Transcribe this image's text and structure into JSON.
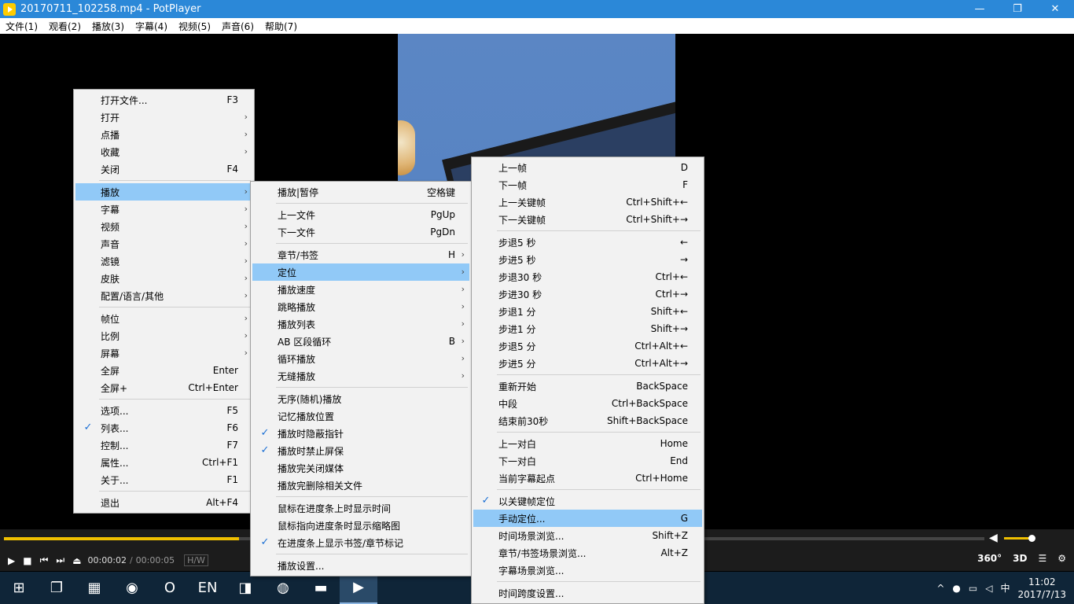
{
  "window": {
    "title": "20170711_102258.mp4 - PotPlayer",
    "min": "—",
    "max": "❐",
    "close": "✕"
  },
  "menubar": [
    "文件(1)",
    "观看(2)",
    "播放(3)",
    "字幕(4)",
    "视频(5)",
    "声音(6)",
    "帮助(7)"
  ],
  "player": {
    "time_current": "00:00:02",
    "time_sep": "/",
    "time_total": "00:00:05",
    "hw": "H/W",
    "progress_fraction": 0.24,
    "volume_fraction": 0.9,
    "btn_360": "360°",
    "btn_3d": "3D",
    "colors": {
      "accent": "#f0c000",
      "highlight": "#91c9f7",
      "titlebar": "#2b88d8"
    }
  },
  "menu_main": [
    {
      "label": "打开文件...",
      "shortcut": "F3"
    },
    {
      "label": "打开",
      "submenu": true
    },
    {
      "label": "点播",
      "submenu": true
    },
    {
      "label": "收藏",
      "submenu": true
    },
    {
      "label": "关闭",
      "shortcut": "F4"
    },
    {
      "sep": true
    },
    {
      "label": "播放",
      "submenu": true,
      "highlighted": true
    },
    {
      "label": "字幕",
      "submenu": true
    },
    {
      "label": "视频",
      "submenu": true
    },
    {
      "label": "声音",
      "submenu": true
    },
    {
      "label": "滤镜",
      "submenu": true
    },
    {
      "label": "皮肤",
      "submenu": true
    },
    {
      "label": "配置/语言/其他",
      "submenu": true
    },
    {
      "sep": true
    },
    {
      "label": "帧位",
      "submenu": true
    },
    {
      "label": "比例",
      "submenu": true
    },
    {
      "label": "屏幕",
      "submenu": true
    },
    {
      "label": "全屏",
      "shortcut": "Enter"
    },
    {
      "label": "全屏+",
      "shortcut": "Ctrl+Enter"
    },
    {
      "sep": true
    },
    {
      "label": "选项...",
      "shortcut": "F5"
    },
    {
      "label": "列表...",
      "shortcut": "F6",
      "checked": true
    },
    {
      "label": "控制...",
      "shortcut": "F7"
    },
    {
      "label": "属性...",
      "shortcut": "Ctrl+F1"
    },
    {
      "label": "关于...",
      "shortcut": "F1"
    },
    {
      "sep": true
    },
    {
      "label": "退出",
      "shortcut": "Alt+F4"
    }
  ],
  "menu_play": [
    {
      "label": "播放|暂停",
      "shortcut": "空格键"
    },
    {
      "sep": true
    },
    {
      "label": "上一文件",
      "shortcut": "PgUp"
    },
    {
      "label": "下一文件",
      "shortcut": "PgDn"
    },
    {
      "sep": true
    },
    {
      "label": "章节/书签",
      "shortcut": "H",
      "submenu": true
    },
    {
      "label": "定位",
      "submenu": true,
      "highlighted": true
    },
    {
      "label": "播放速度",
      "submenu": true
    },
    {
      "label": "跳略播放",
      "submenu": true
    },
    {
      "label": "播放列表",
      "submenu": true
    },
    {
      "label": "AB 区段循环",
      "shortcut": "B",
      "submenu": true
    },
    {
      "label": "循环播放",
      "submenu": true
    },
    {
      "label": "无缝播放",
      "submenu": true
    },
    {
      "sep": true
    },
    {
      "label": "无序(随机)播放"
    },
    {
      "label": "记忆播放位置"
    },
    {
      "label": "播放时隐蔽指针",
      "checked": true
    },
    {
      "label": "播放时禁止屏保",
      "checked": true
    },
    {
      "label": "播放完关闭媒体"
    },
    {
      "label": "播放完删除相关文件"
    },
    {
      "sep": true
    },
    {
      "label": "鼠标在进度条上时显示时间"
    },
    {
      "label": "鼠标指向进度条时显示缩略图"
    },
    {
      "label": "在进度条上显示书签/章节标记",
      "checked": true
    },
    {
      "sep": true
    },
    {
      "label": "播放设置..."
    }
  ],
  "menu_seek": [
    {
      "label": "上一帧",
      "shortcut": "D"
    },
    {
      "label": "下一帧",
      "shortcut": "F"
    },
    {
      "label": "上一关键帧",
      "shortcut": "Ctrl+Shift+←"
    },
    {
      "label": "下一关键帧",
      "shortcut": "Ctrl+Shift+→"
    },
    {
      "sep": true
    },
    {
      "label": "步退5 秒",
      "shortcut": "←"
    },
    {
      "label": "步进5 秒",
      "shortcut": "→"
    },
    {
      "label": "步退30 秒",
      "shortcut": "Ctrl+←"
    },
    {
      "label": "步进30 秒",
      "shortcut": "Ctrl+→"
    },
    {
      "label": "步退1 分",
      "shortcut": "Shift+←"
    },
    {
      "label": "步进1 分",
      "shortcut": "Shift+→"
    },
    {
      "label": "步退5 分",
      "shortcut": "Ctrl+Alt+←"
    },
    {
      "label": "步进5 分",
      "shortcut": "Ctrl+Alt+→"
    },
    {
      "sep": true
    },
    {
      "label": "重新开始",
      "shortcut": "BackSpace"
    },
    {
      "label": "中段",
      "shortcut": "Ctrl+BackSpace"
    },
    {
      "label": "结束前30秒",
      "shortcut": "Shift+BackSpace"
    },
    {
      "sep": true
    },
    {
      "label": "上一对白",
      "shortcut": "Home"
    },
    {
      "label": "下一对白",
      "shortcut": "End"
    },
    {
      "label": "当前字幕起点",
      "shortcut": "Ctrl+Home"
    },
    {
      "sep": true
    },
    {
      "label": "以关键帧定位",
      "checked": true
    },
    {
      "label": "手动定位...",
      "shortcut": "G",
      "highlighted": true
    },
    {
      "label": "时间场景浏览...",
      "shortcut": "Shift+Z"
    },
    {
      "label": "章节/书签场景浏览...",
      "shortcut": "Alt+Z"
    },
    {
      "label": "字幕场景浏览..."
    },
    {
      "sep": true
    },
    {
      "label": "时间跨度设置..."
    }
  ],
  "taskbar": {
    "apps": [
      "windows-start-icon",
      "task-view-icon",
      "calculator-icon",
      "chrome-icon",
      "opera-icon",
      "en-input-icon",
      "tim-icon",
      "office-icon",
      "file-explorer-icon",
      "potplayer-icon"
    ],
    "app_glyphs": [
      "⊞",
      "❐",
      "▦",
      "◉",
      "O",
      "EN",
      "◨",
      "◍",
      "▬",
      "▶"
    ],
    "tray_ime": "中",
    "tray_up": "^",
    "tray_battery": "▭",
    "tray_sound": "◁",
    "clock_time": "11:02",
    "clock_date": "2017/7/13"
  }
}
